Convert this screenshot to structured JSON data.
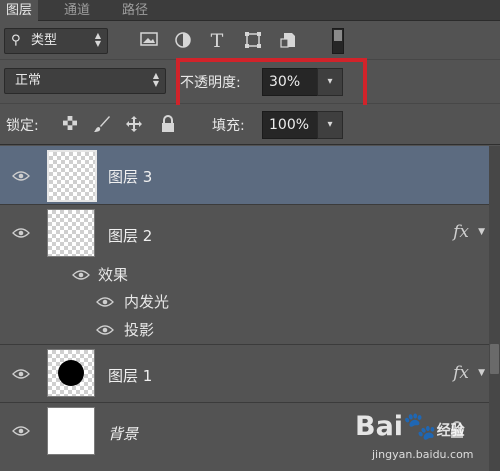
{
  "tabs": [
    {
      "label": "图层",
      "active": true
    },
    {
      "label": "通道",
      "active": false
    },
    {
      "label": "路径",
      "active": false
    }
  ],
  "filter": {
    "label": "类型",
    "icons": [
      "image-filter-icon",
      "adjustment-filter-icon",
      "type-filter-icon",
      "shape-filter-icon",
      "smart-object-filter-icon"
    ]
  },
  "blend_mode": {
    "value": "正常"
  },
  "opacity": {
    "label": "不透明度:",
    "value": "30%"
  },
  "lock": {
    "label": "锁定:"
  },
  "fill": {
    "label": "填充:",
    "value": "100%"
  },
  "layers": [
    {
      "name": "图层 3",
      "selected": true,
      "thumb": "transparent"
    },
    {
      "name": "图层 2",
      "selected": false,
      "thumb": "transparent",
      "fx": "fx",
      "effects_label": "效果",
      "effects": [
        "内发光",
        "投影"
      ]
    },
    {
      "name": "图层 1",
      "selected": false,
      "thumb": "circle",
      "fx": "fx"
    },
    {
      "name": "背景",
      "selected": false,
      "thumb": "white"
    }
  ],
  "watermark": {
    "brand": "Bai",
    "brand_suffix": "经验",
    "url": "jingyan.baidu.com"
  },
  "colors": {
    "highlight": "#d1232a",
    "selected_row": "#5c6b80",
    "panel": "#535353"
  }
}
